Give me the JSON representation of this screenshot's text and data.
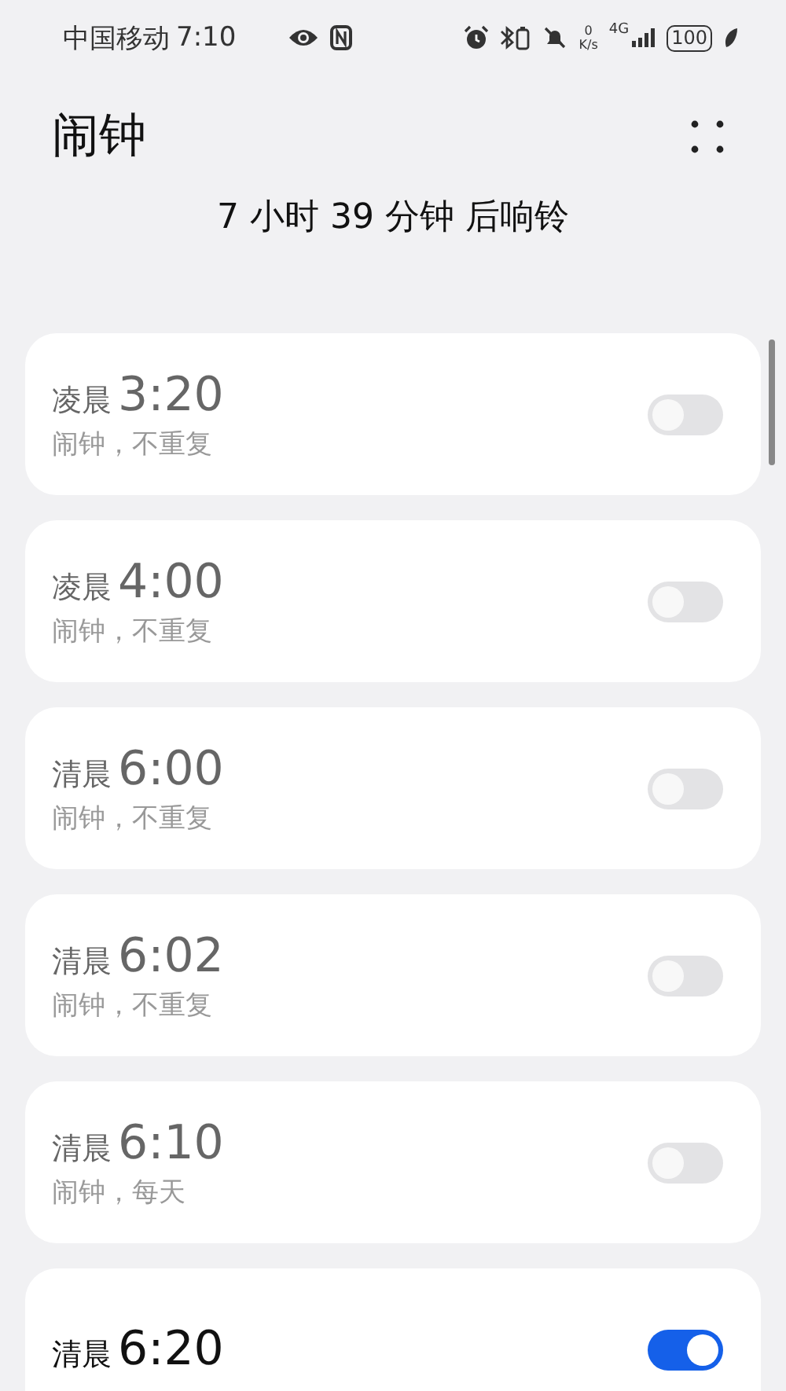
{
  "status_bar": {
    "carrier": "中国移动",
    "time": "7:10",
    "speed_value": "0",
    "speed_unit": "K/s",
    "network": "4G",
    "battery": "100"
  },
  "title": "闹钟",
  "next_alarm": "7 小时 39 分钟 后响铃",
  "alarms": [
    {
      "period": "凌晨",
      "time": "3:20",
      "description": "闹钟，不重复",
      "on": false
    },
    {
      "period": "凌晨",
      "time": "4:00",
      "description": "闹钟，不重复",
      "on": false
    },
    {
      "period": "清晨",
      "time": "6:00",
      "description": "闹钟，不重复",
      "on": false
    },
    {
      "period": "清晨",
      "time": "6:02",
      "description": "闹钟，不重复",
      "on": false
    },
    {
      "period": "清晨",
      "time": "6:10",
      "description": "闹钟，每天",
      "on": false
    },
    {
      "period": "清晨",
      "time": "6:20",
      "on": true
    }
  ]
}
